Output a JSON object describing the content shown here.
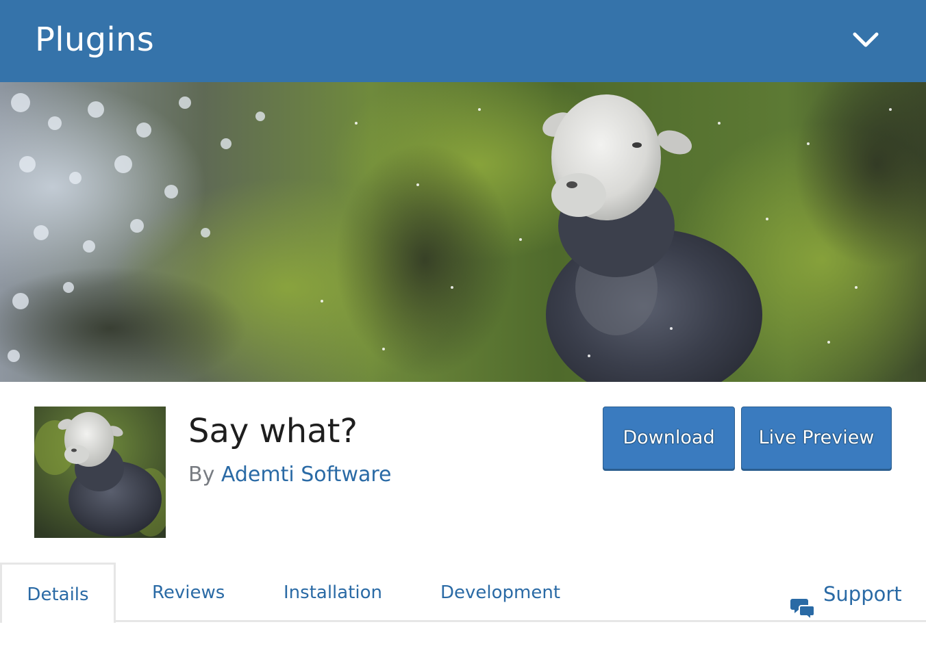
{
  "header": {
    "title": "Plugins",
    "toggle_icon": "chevron-down-icon"
  },
  "banner": {
    "description_icon": "sheep-photo"
  },
  "plugin": {
    "name": "Say what?",
    "by_label": "By",
    "author": "Ademti Software",
    "icon": "sheep-photo"
  },
  "actions": {
    "download": "Download",
    "live_preview": "Live Preview"
  },
  "tabs": [
    {
      "label": "Details",
      "active": true
    },
    {
      "label": "Reviews",
      "active": false
    },
    {
      "label": "Installation",
      "active": false
    },
    {
      "label": "Development",
      "active": false
    }
  ],
  "support": {
    "label": "Support",
    "icon": "speech-bubbles-icon"
  },
  "colors": {
    "header_bg": "#3573aa",
    "button_bg": "#3a7bbf",
    "link": "#2a6aa5"
  }
}
